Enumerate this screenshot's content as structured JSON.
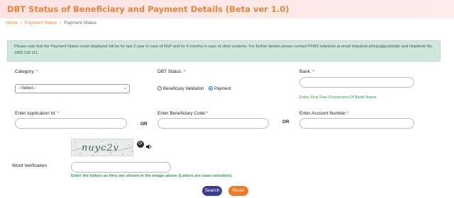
{
  "header": {
    "title": "DBT Status of Beneficiary and Payment Details (Beta ver 1.0)"
  },
  "breadcrumb": [
    {
      "label": "Home"
    },
    {
      "label": "Payment Status"
    },
    {
      "label": "Payment Status"
    }
  ],
  "notice": {
    "text": "Please note that the Payment Status result displayed will be for last 2 year in case of NSP and for 6 months in case of other systems. For further details please contact PFMS helpdesk at email helpdesk-pfms[at]gov[dot]in and Helpdesk No. 1800 118 111."
  },
  "form": {
    "category": {
      "label": "Category:",
      "value": "--Select--"
    },
    "dbt_status": {
      "label": "DBT Status:",
      "options": [
        {
          "label": "Beneficiary Validation",
          "selected": false
        },
        {
          "label": "Payment",
          "selected": true
        }
      ]
    },
    "bank": {
      "label": "Bank:",
      "value": "",
      "hint": "Enter First Few Characters Of Bank Name"
    },
    "application_id": {
      "label": "Enter Application Id:",
      "value": ""
    },
    "beneficiary_code": {
      "label": "Enter Beneficiary Code:",
      "value": ""
    },
    "account_number": {
      "label": "Enter Account Number:",
      "value": ""
    },
    "or_label": "OR",
    "captcha": {
      "text": "nuyc2v"
    },
    "word_verification": {
      "label": "Word Verification",
      "value": "",
      "hint": "Enter the letters as they are shown in the image above (Letters are case-sensitive)."
    },
    "required_mark": "*"
  },
  "actions": {
    "search_label": "Search",
    "reset_label": "Reset"
  },
  "colors": {
    "accent": "#e8833a",
    "notice_bg": "#cfe7dc",
    "hint_green": "#2e9b47",
    "search_btn": "#3a3f8f",
    "reset_btn": "#ec7a2a"
  }
}
